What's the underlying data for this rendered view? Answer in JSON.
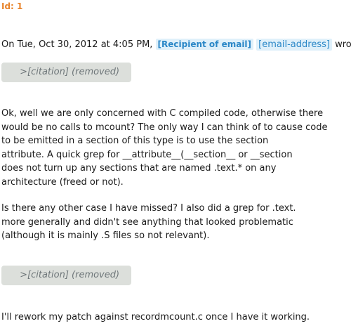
{
  "message": {
    "id_label": "Id: 1",
    "header": {
      "prefix": "On Tue, Oct 30, 2012 at 4:05 PM, ",
      "recipient_tag": "[Recipient of email]",
      "email_tag": "[email-address]",
      "suffix": " wrote:"
    },
    "citations": [
      " >[citation] (removed)",
      " >[citation] (removed)"
    ],
    "paragraphs": [
      [
        "Ok, well we are only concerned with C compiled code, otherwise there",
        "would be no calls to mcount? The only way I can think of to cause code",
        "to be emitted in a section of this type is to use the section",
        "attribute. A quick grep for __attribute__(__section__ or __section",
        "does not turn up any sections that are named .text.* on any",
        "architecture (freed or not)."
      ],
      [
        "Is there any other case I have missed? I also did a grep for .text.",
        "more generally and didn't see anything that looked problematic",
        "(although it is mainly .S files so not relevant)."
      ],
      [
        "I'll rework my patch against recordmcount.c once I have it working."
      ]
    ]
  }
}
